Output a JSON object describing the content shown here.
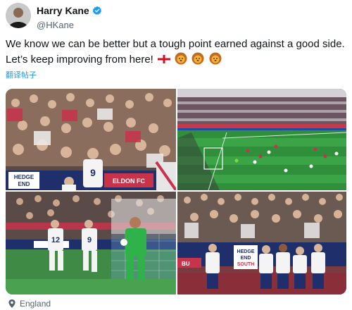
{
  "author": {
    "display_name": "Harry Kane",
    "handle": "@HKane"
  },
  "tweet": {
    "line1": "We know we can be better but a tough point earned against a good side.",
    "line2": "Let’s keep improving from here!",
    "emojis": [
      "england-flag",
      "lion-face",
      "lion-face",
      "lion-face"
    ]
  },
  "translate_label": "翻译帖子",
  "photos": {
    "p1_banner_left": "HEDGE\nEND",
    "p1_banner_mid": "ELDON FC",
    "p1_shirt_number": "9",
    "p3_shirt_number_a": "12",
    "p3_shirt_number_b": "9",
    "p4_banner": "HEDGE\nEND\nSOUTH",
    "p4_banner_left": "BU"
  },
  "location": {
    "label": "England"
  },
  "colors": {
    "accent": "#1d9bf0",
    "muted": "#536471",
    "text": "#0f1419",
    "verified": "#1d9bf0",
    "pitch": "#2f8f3a"
  }
}
